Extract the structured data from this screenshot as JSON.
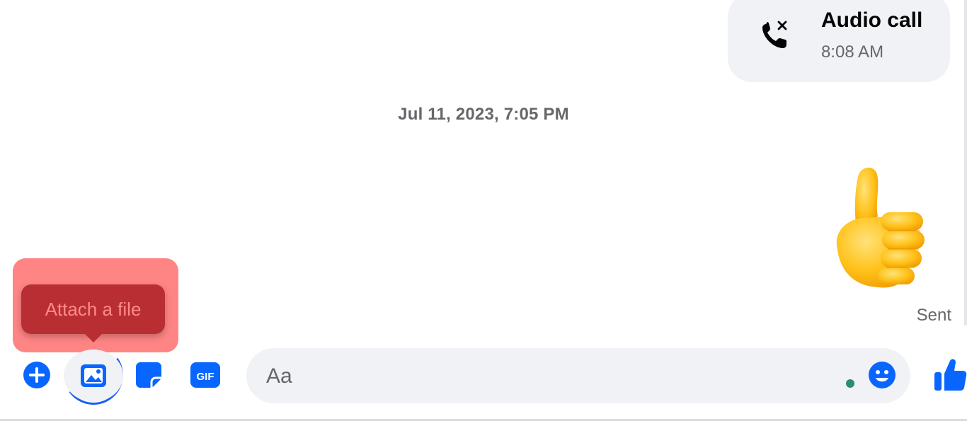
{
  "conversation": {
    "call_event": {
      "title": "Audio call",
      "time": "8:08 AM",
      "icon": "missed-call-icon"
    },
    "date_separator": "Jul 11, 2023, 7:05 PM",
    "last_message": {
      "type": "emoji",
      "emoji": "thumbs-up",
      "status": "Sent"
    }
  },
  "tooltip": {
    "text": "Attach a file"
  },
  "composer": {
    "buttons": [
      {
        "name": "more-actions",
        "icon": "plus-circle-icon"
      },
      {
        "name": "attach-file",
        "icon": "image-icon"
      },
      {
        "name": "sticker",
        "icon": "sticker-icon"
      },
      {
        "name": "gif",
        "icon": "gif-icon",
        "label": "GIF"
      }
    ],
    "input_placeholder": "Aa",
    "emoji_icon": "smiley-icon",
    "like_icon": "thumbs-up-icon"
  },
  "colors": {
    "accent": "#0866ff",
    "bubble_bg": "#f0f2f5",
    "secondary_text": "#65676b",
    "tooltip_bg": "#b82e33",
    "highlight": "#ff7b7b"
  }
}
